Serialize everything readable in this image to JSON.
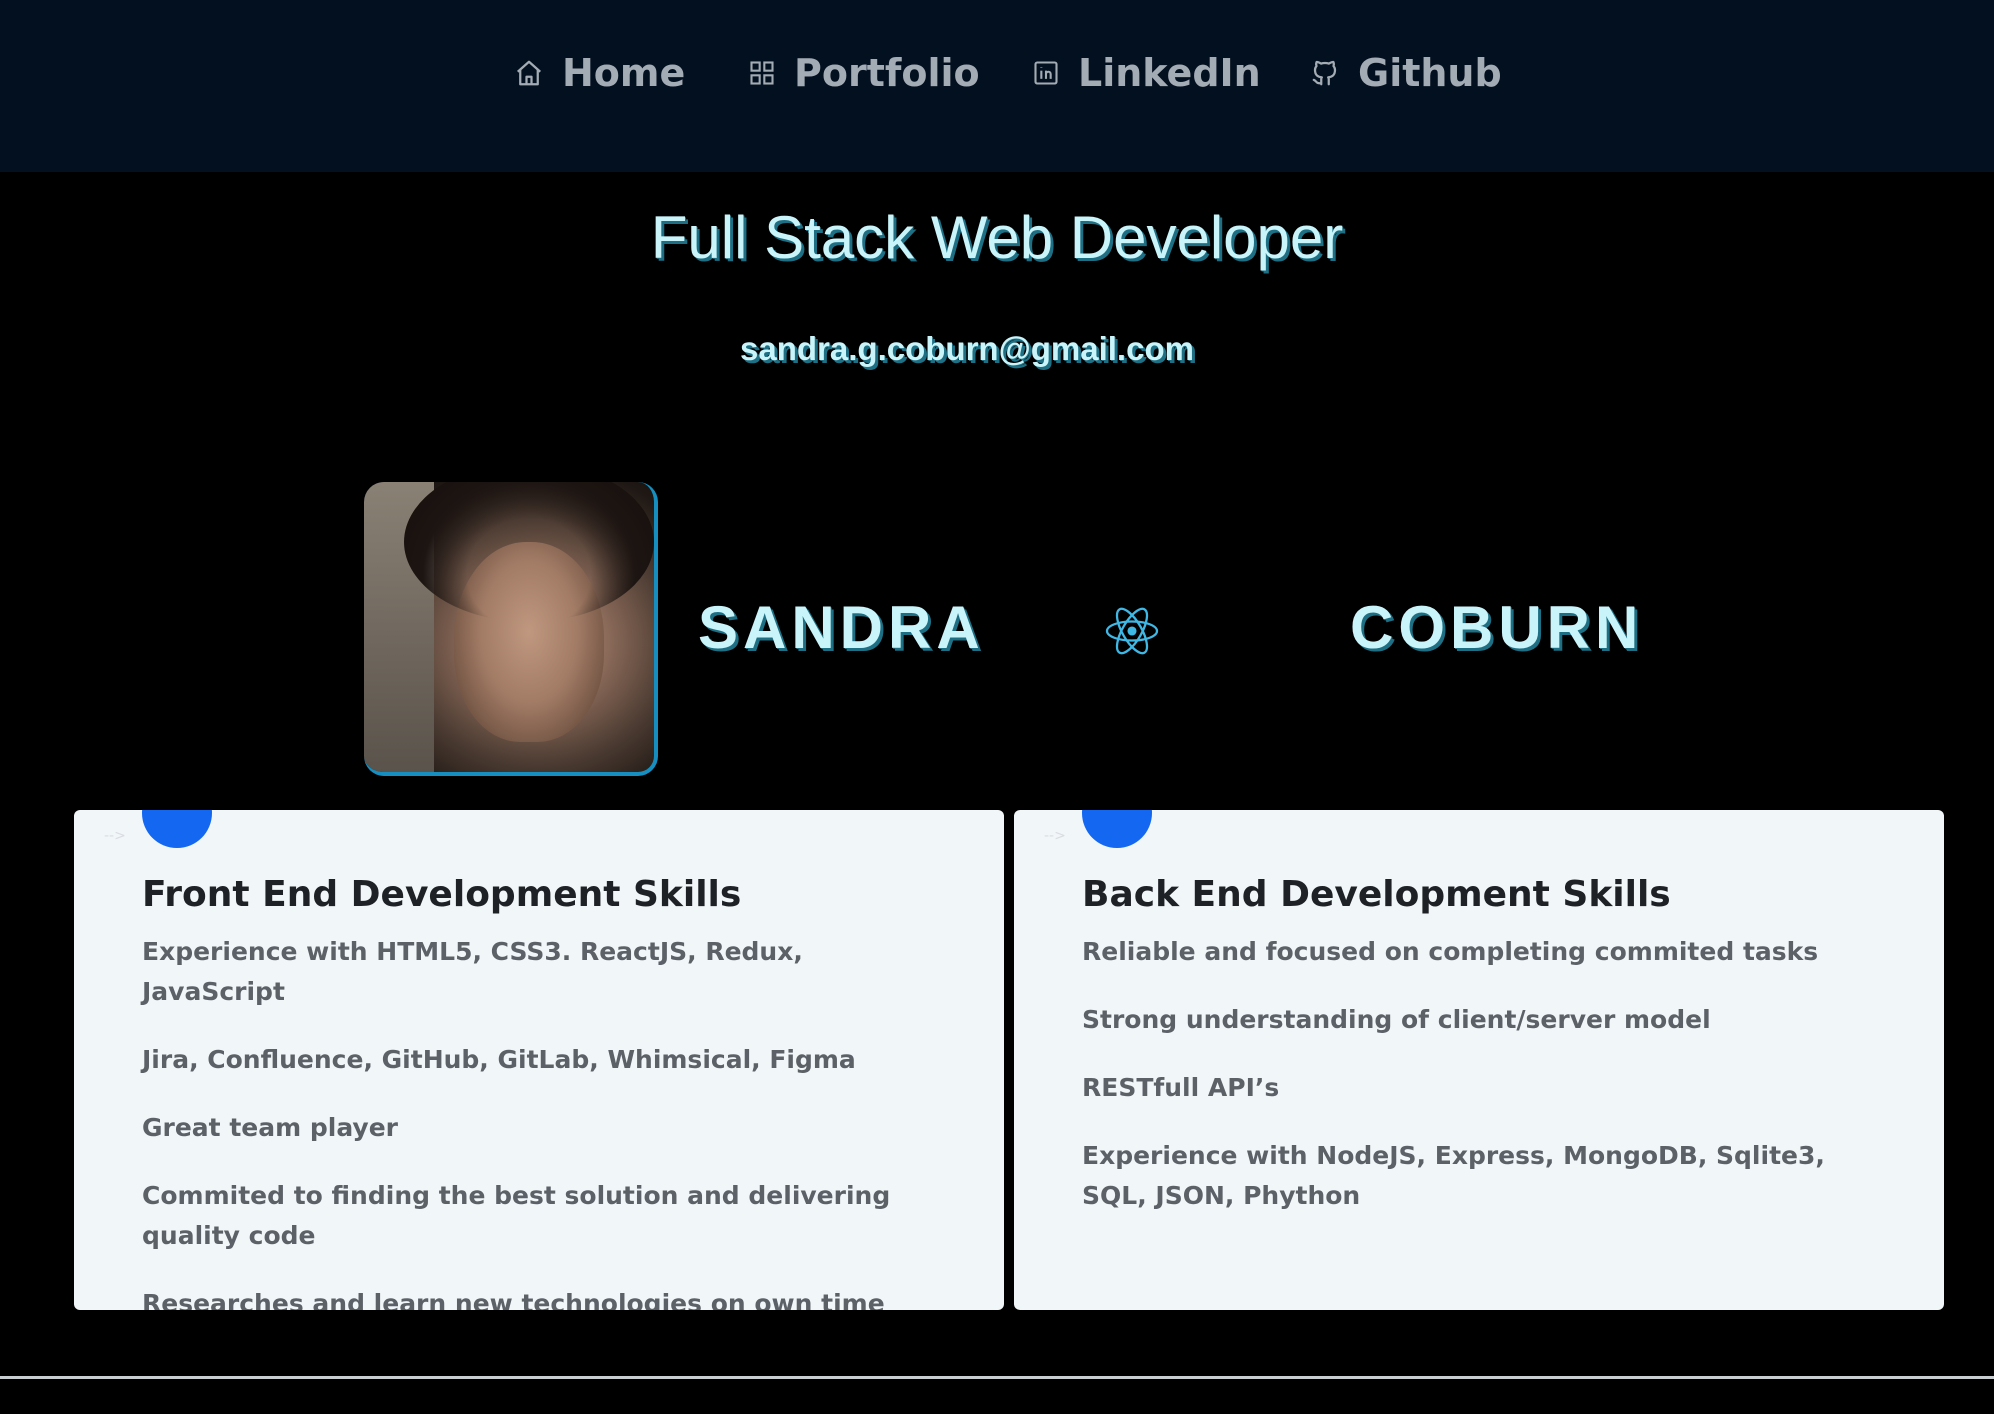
{
  "nav": {
    "items": [
      {
        "label": "Home",
        "icon": "home-icon"
      },
      {
        "label": "Portfolio",
        "icon": "grid-icon"
      },
      {
        "label": "LinkedIn",
        "icon": "linkedin-icon"
      },
      {
        "label": "Github",
        "icon": "github-icon"
      }
    ]
  },
  "hero": {
    "headline": "Full Stack Web Developer",
    "email": "sandra.g.coburn@gmail.com",
    "first_name": "SANDRA",
    "last_name": "COBURN"
  },
  "cards": [
    {
      "arrow": "-->",
      "title": "Front End Development Skills",
      "items": [
        "Experience with HTML5, CSS3. ReactJS, Redux, JavaScript",
        "Jira, Confluence, GitHub, GitLab, Whimsical, Figma",
        "Great team player",
        "Commited to finding the best solution and delivering quality code",
        "Researches and learn new technologies on own time"
      ]
    },
    {
      "arrow": "-->",
      "title": "Back End Development Skills",
      "items": [
        "Reliable and focused on completing commited tasks",
        "Strong understanding of client/server model",
        "RESTfull API’s",
        "Experience with NodeJS, Express, MongoDB, Sqlite3, SQL, JSON, Phython"
      ]
    }
  ],
  "colors": {
    "nav_background": "#03101f",
    "page_background": "#000000",
    "headline_text": "#c8f4fa",
    "card_background": "#f1f6f9",
    "accent_blue": "#1467f0",
    "react_cyan": "#3fb8e6"
  }
}
